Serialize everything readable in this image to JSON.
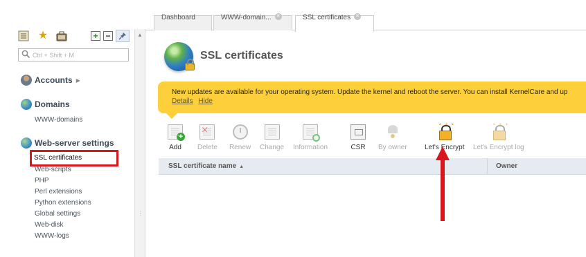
{
  "sidebar": {
    "toolbar_icons": [
      "list-icon",
      "star-icon",
      "briefcase-icon",
      "expand-all-icon",
      "collapse-all-icon",
      "pin-icon"
    ],
    "search_placeholder": "Ctrl + Shift + M",
    "groups": [
      {
        "label": "Accounts",
        "icon": "user-icon",
        "has_arrow": true
      },
      {
        "label": "Domains",
        "icon": "globe-icon",
        "items": [
          "WWW-domains"
        ]
      },
      {
        "label": "Web-server settings",
        "icon": "web-globe-icon",
        "items": [
          "SSL certificates",
          "Web-scripts",
          "PHP",
          "Perl extensions",
          "Python extensions",
          "Global settings",
          "Web-disk",
          "WWW-logs"
        ],
        "selected": "SSL certificates"
      }
    ]
  },
  "tabs": [
    {
      "label": "Dashboard",
      "closable": false
    },
    {
      "label": "WWW-domain...",
      "closable": true
    },
    {
      "label": "SSL certificates",
      "closable": true,
      "active": true
    }
  ],
  "page": {
    "title": "SSL certificates",
    "banner": {
      "message": "New updates are available for your operating system. Update the kernel and reboot the server. You can install KernelCare and up",
      "links": [
        "Details",
        "Hide"
      ],
      "color": "#fccf3b"
    }
  },
  "toolbar": [
    {
      "label": "Add",
      "enabled": true
    },
    {
      "label": "Delete",
      "enabled": false
    },
    {
      "label": "Renew",
      "enabled": false
    },
    {
      "label": "Change",
      "enabled": false
    },
    {
      "label": "Information",
      "enabled": false
    },
    {
      "label": "CSR",
      "enabled": true
    },
    {
      "label": "By owner",
      "enabled": false
    },
    {
      "label": "Let's Encrypt",
      "enabled": true
    },
    {
      "label": "Let's Encrypt log",
      "enabled": false
    }
  ],
  "table": {
    "columns": [
      "SSL certificate name",
      "Owner"
    ],
    "sorted_column": "SSL certificate name",
    "sort_direction": "ascending"
  },
  "annotation": {
    "highlight_color": "#d8171d"
  }
}
